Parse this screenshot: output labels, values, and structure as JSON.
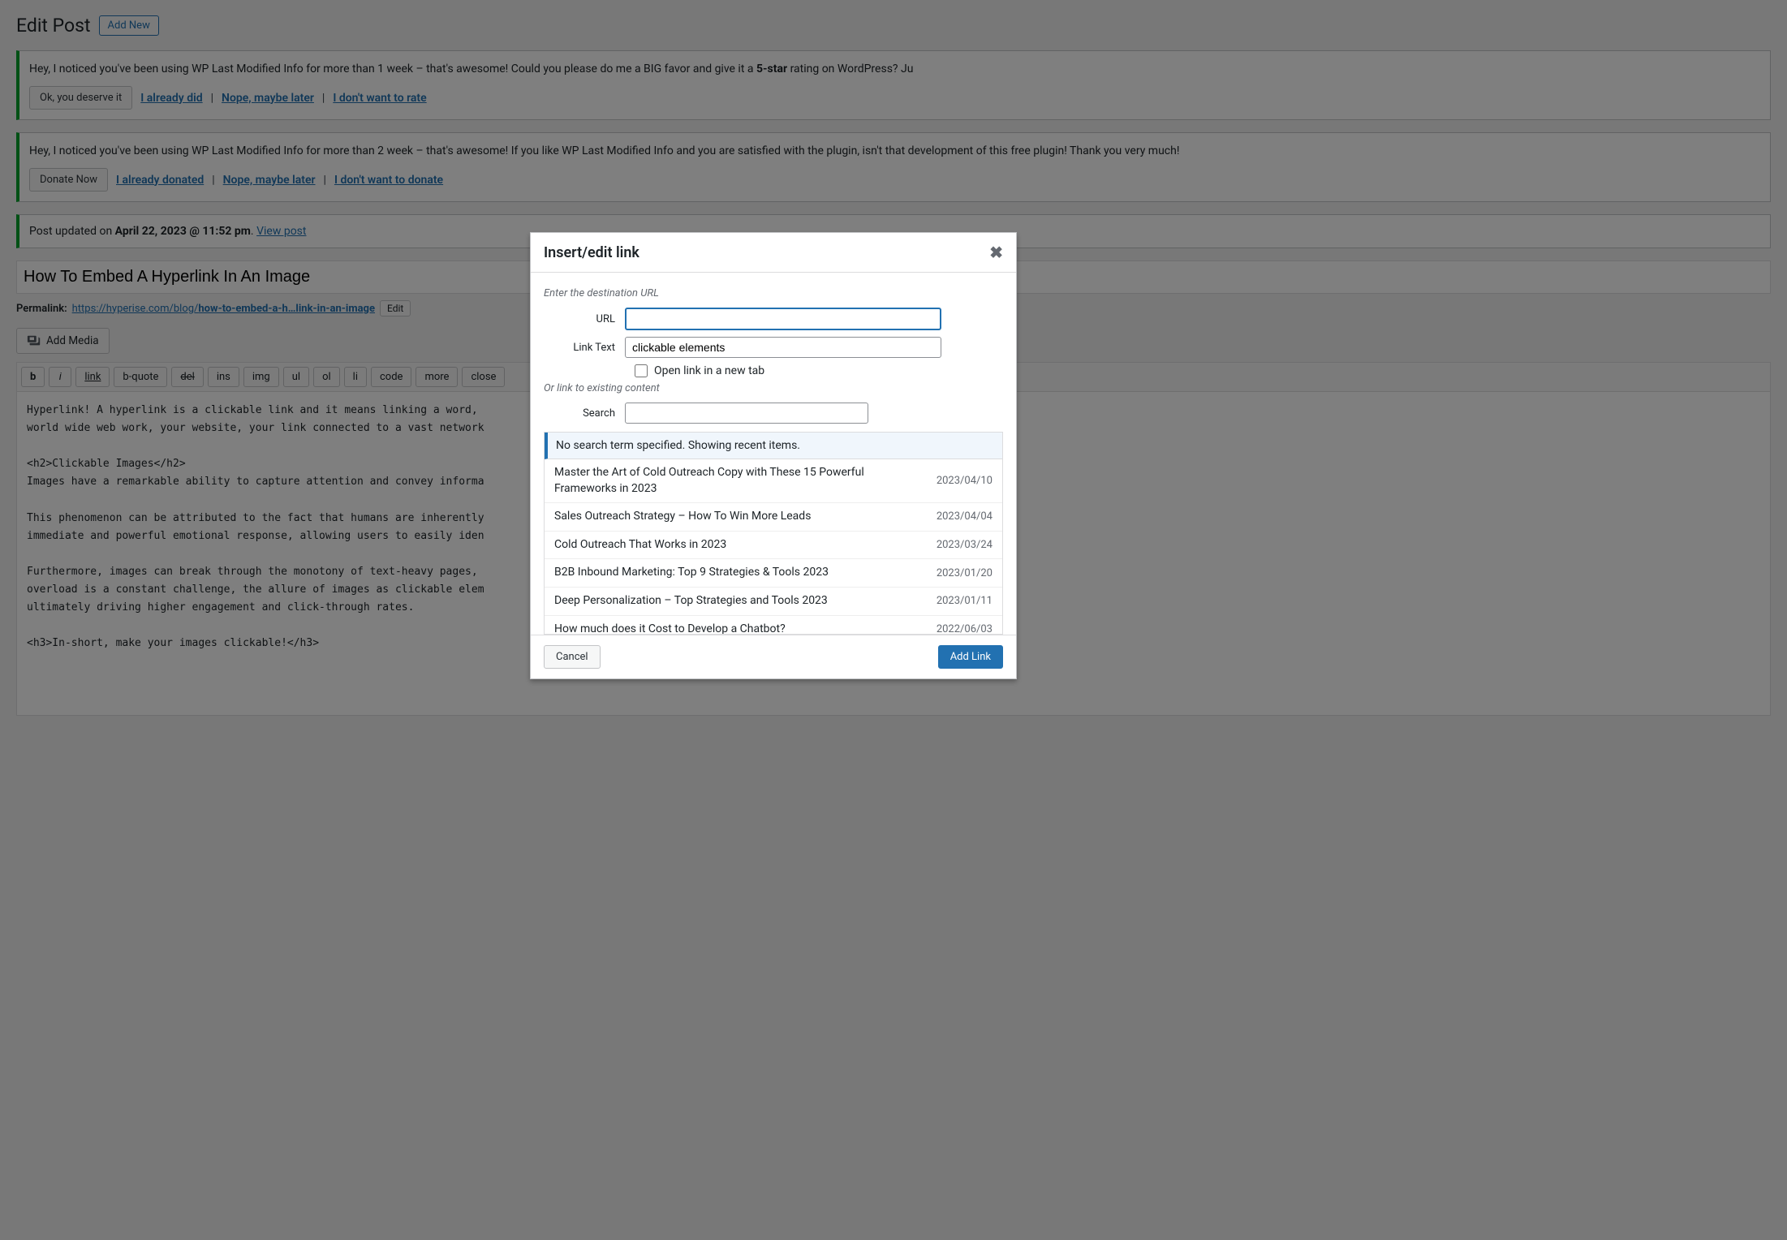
{
  "page": {
    "title": "Edit Post",
    "add_new": "Add New"
  },
  "notice1": {
    "text_pre": "Hey, I noticed you've been using WP Last Modified Info for more than 1 week – that's awesome! Could you please do me a BIG favor and give it a ",
    "text_bold": "5-star",
    "text_post": " rating on WordPress? Ju",
    "btn": "Ok, you deserve it",
    "link1": "I already did",
    "link2": "Nope, maybe later",
    "link3": "I don't want to rate",
    "sep": "|"
  },
  "notice2": {
    "text": "Hey, I noticed you've been using WP Last Modified Info for more than 2 week – that's awesome! If you like WP Last Modified Info and you are satisfied with the plugin, isn't that development of this free plugin! Thank you very much!",
    "btn": "Donate Now",
    "link1": "I already donated",
    "link2": "Nope, maybe later",
    "link3": "I don't want to donate",
    "sep": "|"
  },
  "updated": {
    "pre": "Post updated on ",
    "bold": "April 22, 2023 @ 11:52 pm",
    "dot": ". ",
    "view": "View post"
  },
  "post": {
    "title": "How To Embed A Hyperlink In An Image",
    "permalink_label": "Permalink:",
    "permalink_base": "https://hyperise.com/blog/",
    "permalink_slug": "how-to-embed-a-h…link-in-an-image",
    "edit_btn": "Edit"
  },
  "media_btn": "Add Media",
  "quicktags": {
    "b": "b",
    "i": "i",
    "link": "link",
    "bquote": "b-quote",
    "del": "del",
    "ins": "ins",
    "img": "img",
    "ul": "ul",
    "ol": "ol",
    "li": "li",
    "code": "code",
    "more": "more",
    "close": "close"
  },
  "editor": {
    "content": "Hyperlink! A hyperlink is a clickable link and it means linking a word,                                                                r new we\nworld wide web work, your website, your link connected to a vast network                                                               raffic,\n\n<h2>Clickable Images</h2>\nImages have a remarkable ability to capture attention and convey informa                                                               the digit\n\nThis phenomenon can be attributed to the fact that humans are inherently                                                                er than\nimmediate and powerful emotional response, allowing users to easily iden\n\nFurthermore, images can break through the monotony of text-heavy pages,                                                                e with t\noverload is a constant challenge, the allure of images as clickable elem                                                               mpelling\nultimately driving higher engagement and click-through rates.\n\n<h3>In-short, make your images clickable!</h3>"
  },
  "dialog": {
    "title": "Insert/edit link",
    "howto1": "Enter the destination URL",
    "url_label": "URL",
    "url_value": "",
    "linktext_label": "Link Text",
    "linktext_value": "clickable elements",
    "newtab_label": "Open link in a new tab",
    "howto2": "Or link to existing content",
    "search_label": "Search",
    "search_value": "",
    "results_header": "No search term specified. Showing recent items.",
    "results": [
      {
        "title": "Master the Art of Cold Outreach Copy with These 15 Powerful Frameworks in 2023",
        "date": "2023/04/10"
      },
      {
        "title": "Sales Outreach Strategy – How To Win More Leads",
        "date": "2023/04/04"
      },
      {
        "title": "Cold Outreach That Works in 2023",
        "date": "2023/03/24"
      },
      {
        "title": "B2B Inbound Marketing: Top 9 Strategies & Tools 2023",
        "date": "2023/01/20"
      },
      {
        "title": "Deep Personalization – Top Strategies and Tools 2023",
        "date": "2023/01/11"
      },
      {
        "title": "How much does it Cost to Develop a Chatbot?",
        "date": "2022/06/03"
      }
    ],
    "cancel": "Cancel",
    "submit": "Add Link"
  }
}
